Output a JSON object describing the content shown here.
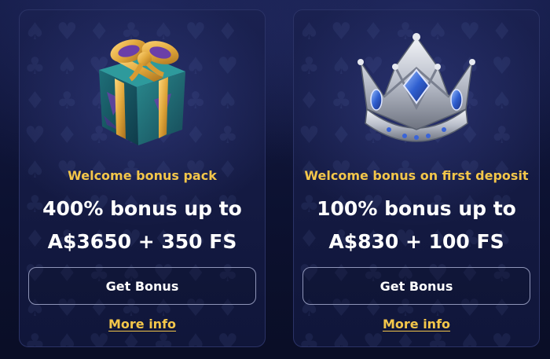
{
  "cards": [
    {
      "illustration": "gift-box-icon",
      "subtitle": "Welcome bonus pack",
      "headline_line1": "400% bonus up to",
      "headline_line2": "A$3650 + 350 FS",
      "button_label": "Get Bonus",
      "link_label": "More info"
    },
    {
      "illustration": "crown-icon",
      "subtitle": "Welcome bonus on first deposit",
      "headline_line1": "100% bonus up to",
      "headline_line2": "A$830 + 100 FS",
      "button_label": "Get Bonus",
      "link_label": "More info"
    }
  ],
  "colors": {
    "background": "#0d1230",
    "card_border": "#2b3366",
    "accent_gold": "#f3c64a",
    "text_white": "#ffffff"
  }
}
